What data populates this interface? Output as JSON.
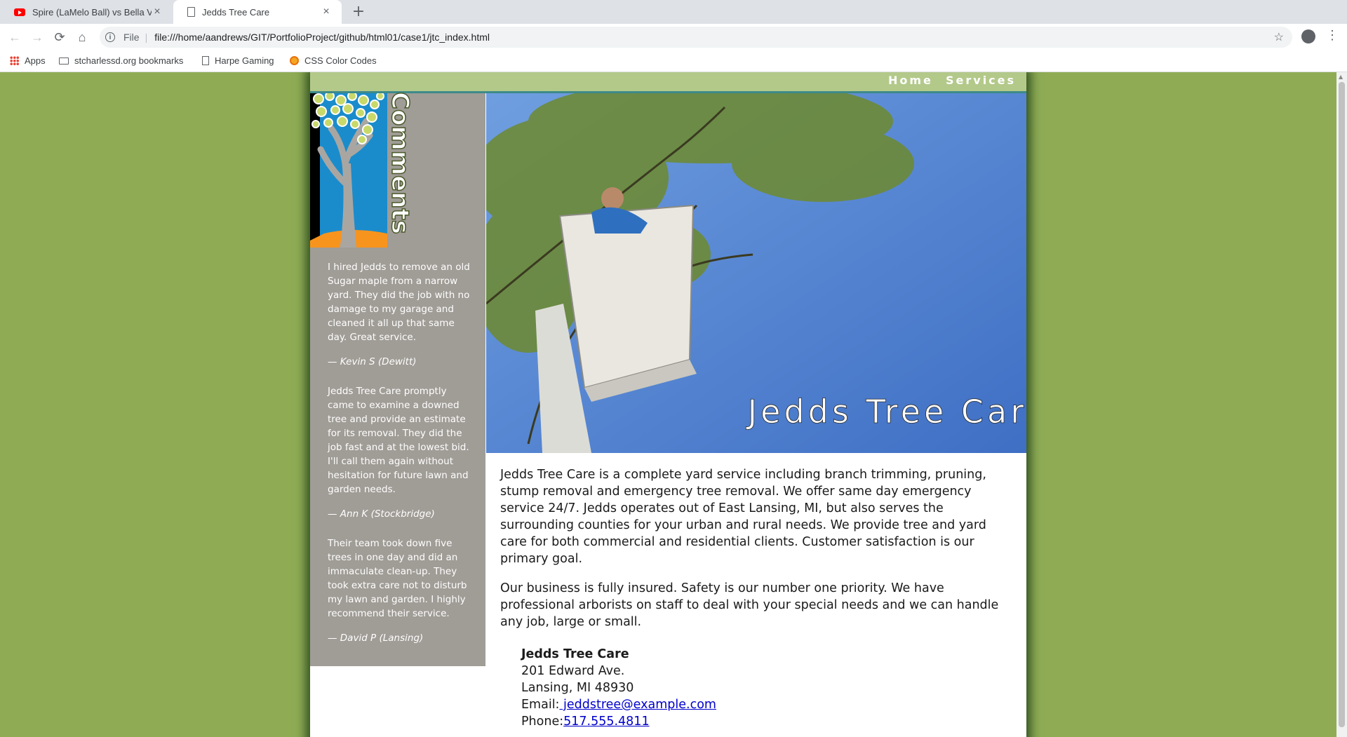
{
  "browser": {
    "tabs": [
      {
        "title": "Spire (LaMelo Ball) vs Bella Vi",
        "close": "×"
      },
      {
        "title": "Jedds Tree Care",
        "close": "×"
      }
    ],
    "new_tab": "+",
    "file_label": "File",
    "url": "file:///home/aandrews/GIT/PortfolioProject/github/html01/case1/jtc_index.html",
    "bookmarks": [
      "Apps",
      "stcharlessd.org bookmarks",
      "Harpe Gaming",
      "CSS Color Codes"
    ]
  },
  "site": {
    "nav": [
      "Home",
      "Services"
    ],
    "sidebar_heading": "Comments",
    "testimonials": [
      {
        "quote": "I hired Jedds to remove an old Sugar maple from a narrow yard. They did the job with no damage to my garage and cleaned it all up that same day. Great service.",
        "author": "— Kevin S (Dewitt)"
      },
      {
        "quote": "Jedds Tree Care promptly came to examine a downed tree and provide an estimate for its removal. They did the job fast and at the lowest bid. I'll call them again without hesitation for future lawn and garden needs.",
        "author": "— Ann K (Stockbridge)"
      },
      {
        "quote": "Their team took down five trees in one day and did an immaculate clean-up. They took extra care not to disturb my lawn and garden. I highly recommend their service.",
        "author": "— David P (Lansing)"
      }
    ],
    "hero_title": "Jedds Tree Care",
    "paragraphs": [
      "Jedds Tree Care is a complete yard service including branch trimming, pruning, stump removal and emergency tree removal. We offer same day emergency service 24/7. Jedds operates out of East Lansing, MI, but also serves the surrounding counties for your urban and rural needs. We provide tree and yard care for both commercial and residential clients. Customer satisfaction is our primary goal.",
      "Our business is fully insured. Safety is our number one priority. We have professional arborists on staff to deal with your special needs and we can handle any job, large or small."
    ],
    "address": {
      "name": "Jedds Tree Care",
      "street": "201 Edward Ave.",
      "city": "Lansing, MI 48930",
      "email_label": "Email:",
      "email": " jeddstree@example.com",
      "phone_label": "Phone:",
      "phone": "517.555.4811"
    }
  },
  "colors": {
    "page_bg": "#8fac55",
    "nav_bar": "#b3c98a",
    "sidebar": "#a09c96",
    "sky": "#4a7fd0",
    "link": "#0000cc"
  }
}
